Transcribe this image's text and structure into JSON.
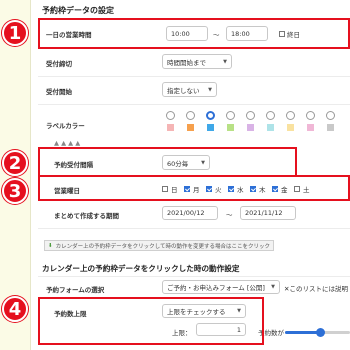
{
  "section1": {
    "title": "予約枠データの設定"
  },
  "hours": {
    "label": "一日の営業時間",
    "start": "10:00",
    "sep": "〜",
    "end": "18:00",
    "allday": "終日",
    "allday_checked": false
  },
  "deadline": {
    "label": "受付締切",
    "value": "時間開始まで"
  },
  "start": {
    "label": "受付開始",
    "value": "指定しない"
  },
  "labelcolor": {
    "label": "ラベルカラー",
    "colors": [
      "#f5b5b5",
      "#f6a04d",
      "#3fa8e8",
      "#b8e186",
      "#d9b3e6",
      "#aee3e8",
      "#f9e2a0",
      "#f0b7d6",
      "#c9c9c9"
    ],
    "selected_index": 2
  },
  "interval": {
    "label": "予約受付間隔",
    "value": "60分毎"
  },
  "days": {
    "label": "営業曜日",
    "items": [
      {
        "label": "日",
        "checked": false
      },
      {
        "label": "月",
        "checked": true
      },
      {
        "label": "火",
        "checked": true
      },
      {
        "label": "水",
        "checked": true
      },
      {
        "label": "木",
        "checked": true
      },
      {
        "label": "金",
        "checked": true
      },
      {
        "label": "土",
        "checked": false
      }
    ]
  },
  "period": {
    "label": "まとめて作成する期間",
    "from": "2021/00/12",
    "sep": "〜",
    "to": "2021/11/12"
  },
  "banner": {
    "text": "カレンダー上の予約枠データをクリックして時の動作を変更する場合はここをクリック"
  },
  "section2": {
    "title": "カレンダー上の予約枠データをクリックした時の動作設定"
  },
  "form": {
    "label": "予約フォームの選択",
    "value": "ご予約・お申込みフォーム [公開]",
    "note": "✕このリストには説明"
  },
  "limit": {
    "label": "予約数上限",
    "select": "上限をチェックする",
    "upper_label": "上限：",
    "upper_value": "1",
    "slider_label": "予約数が",
    "slider_fraction": 0.55
  },
  "badges": [
    "1",
    "2",
    "3",
    "4"
  ],
  "colors": {
    "accent": "#e5101e",
    "primary": "#2d6fd6"
  }
}
